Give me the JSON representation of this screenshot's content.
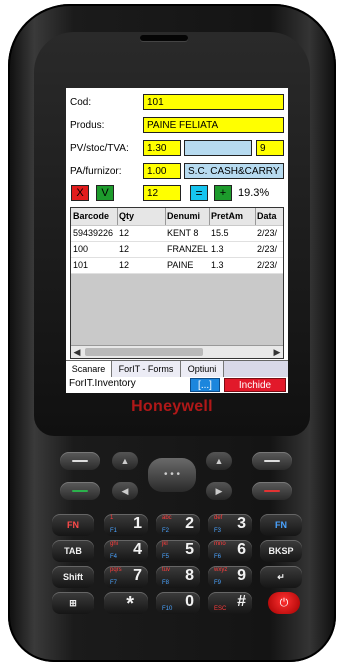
{
  "device": {
    "brand": "Honeywell"
  },
  "form": {
    "cod_label": "Cod:",
    "cod_value": "101",
    "produs_label": "Produs:",
    "produs_value": "PAINE FELIATA",
    "pv_label": "PV/stoc/TVA:",
    "pv_value": "1.30",
    "stoc_value": "",
    "tva_value": "9",
    "pa_label": "PA/furnizor:",
    "pa_value": "1.00",
    "furnizor_value": "S.C. CASH&CARRY",
    "x_label": "X",
    "v_label": "V",
    "qty_value": "12",
    "eq_label": "=",
    "plus_label": "+",
    "percent": "19.3%"
  },
  "table": {
    "headers": [
      "Barcode",
      "Qty",
      "Denumi",
      "PretAm",
      "Data"
    ],
    "rows": [
      [
        "59439226",
        "12",
        "KENT 8",
        "15.5",
        "2/23/"
      ],
      [
        "100",
        "12",
        "FRANZEL",
        "1.3",
        "2/23/"
      ],
      [
        "101",
        "12",
        "PAINE",
        "1.3",
        "2/23/"
      ]
    ]
  },
  "tabs": [
    "Scanare",
    "ForIT - Forms",
    "Optiuni"
  ],
  "status": {
    "title": "ForIT.Inventory",
    "dots": "[...]",
    "close": "Inchide"
  },
  "keys": {
    "row1": [
      {
        "alt": "",
        "main": "FN",
        "sub": ""
      },
      {
        "alt": "1",
        "main": "1",
        "sub": "F1"
      },
      {
        "alt": "abc",
        "main": "2",
        "sub": "F2"
      },
      {
        "alt": "def",
        "main": "3",
        "sub": "F3"
      },
      {
        "alt": "",
        "main": "FN",
        "sub": ""
      }
    ],
    "row2": [
      {
        "alt": "",
        "main": "TAB",
        "sub": ""
      },
      {
        "alt": "ghi",
        "main": "4",
        "sub": "F4"
      },
      {
        "alt": "jkl",
        "main": "5",
        "sub": "F5"
      },
      {
        "alt": "mno",
        "main": "6",
        "sub": "F6"
      },
      {
        "alt": "",
        "main": "BKSP",
        "sub": ""
      }
    ],
    "row3": [
      {
        "alt": "",
        "main": "Shift",
        "sub": ""
      },
      {
        "alt": "pqrs",
        "main": "7",
        "sub": "F7"
      },
      {
        "alt": "tuv",
        "main": "8",
        "sub": "F8"
      },
      {
        "alt": "wxyz",
        "main": "9",
        "sub": "F9"
      },
      {
        "alt": "",
        "main": "↵",
        "sub": ""
      }
    ],
    "row4": [
      {
        "alt": "",
        "main": "⊞",
        "sub": ""
      },
      {
        "alt": "",
        "main": "*",
        "sub": ""
      },
      {
        "alt": "",
        "main": "0",
        "sub": "F10"
      },
      {
        "alt": "",
        "main": "#",
        "sub": "ESC"
      }
    ]
  },
  "colors": {
    "field_yellow": "#ffff00",
    "field_blue": "#b7dbf0",
    "brand_red": "#b01818",
    "close_red": "#e2192a",
    "dots_blue": "#1c86dd"
  }
}
